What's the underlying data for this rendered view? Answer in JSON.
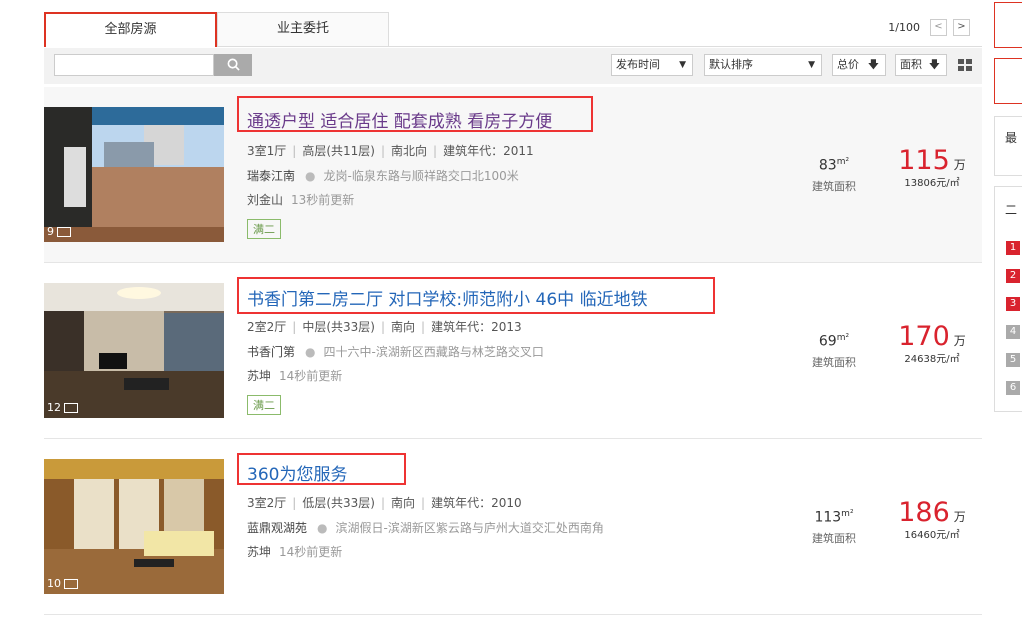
{
  "tabs": {
    "all": "全部房源",
    "owner": "业主委托"
  },
  "pager": {
    "page": "1/100",
    "prev": "<",
    "next": ">"
  },
  "toolbar": {
    "search_value": "",
    "sort_time": "发布时间",
    "sort_default": "默认排序",
    "sort_price": "总价",
    "sort_area": "面积"
  },
  "listings": [
    {
      "title": "通透户型 适合居住 配套成熟 看房子方便",
      "layout": "3室1厅",
      "floor": "高层(共11层)",
      "orientation": "南北向",
      "year": "建筑年代：2011",
      "community": "瑞泰江南",
      "address": "龙岗-临泉东路与顺祥路交口北100米",
      "agent": "刘金山",
      "updated": "13秒前更新",
      "tag": "满二",
      "area": "83",
      "area_label": "建筑面积",
      "price": "115",
      "price_unit": "万",
      "unit_price": "13806元/㎡",
      "photos": "9"
    },
    {
      "title": "书香门第二房二厅 对口学校:师范附小 46中 临近地铁",
      "layout": "2室2厅",
      "floor": "中层(共33层)",
      "orientation": "南向",
      "year": "建筑年代：2013",
      "community": "书香门第",
      "address": "四十六中-滨湖新区西藏路与林芝路交叉口",
      "agent": "苏坤",
      "updated": "14秒前更新",
      "tag": "满二",
      "area": "69",
      "area_label": "建筑面积",
      "price": "170",
      "price_unit": "万",
      "unit_price": "24638元/㎡",
      "photos": "12"
    },
    {
      "title": "360为您服务",
      "layout": "3室2厅",
      "floor": "低层(共33层)",
      "orientation": "南向",
      "year": "建筑年代：2010",
      "community": "蓝鼎观湖苑",
      "address": "滨湖假日-滨湖新区紫云路与庐州大道交汇处西南角",
      "agent": "苏坤",
      "updated": "14秒前更新",
      "area": "113",
      "area_label": "建筑面积",
      "price": "186",
      "price_unit": "万",
      "unit_price": "16460元/㎡",
      "photos": "10"
    }
  ],
  "sidebar": {
    "label_recent": "最",
    "label_two": "二",
    "ranks": [
      "1",
      "2",
      "3",
      "4",
      "5",
      "6"
    ]
  },
  "colors": {
    "accent_red": "#d9232e",
    "link_blue": "#2366b8",
    "visited_purple": "#6a3a8a",
    "tag_green": "#6a9a4a"
  }
}
